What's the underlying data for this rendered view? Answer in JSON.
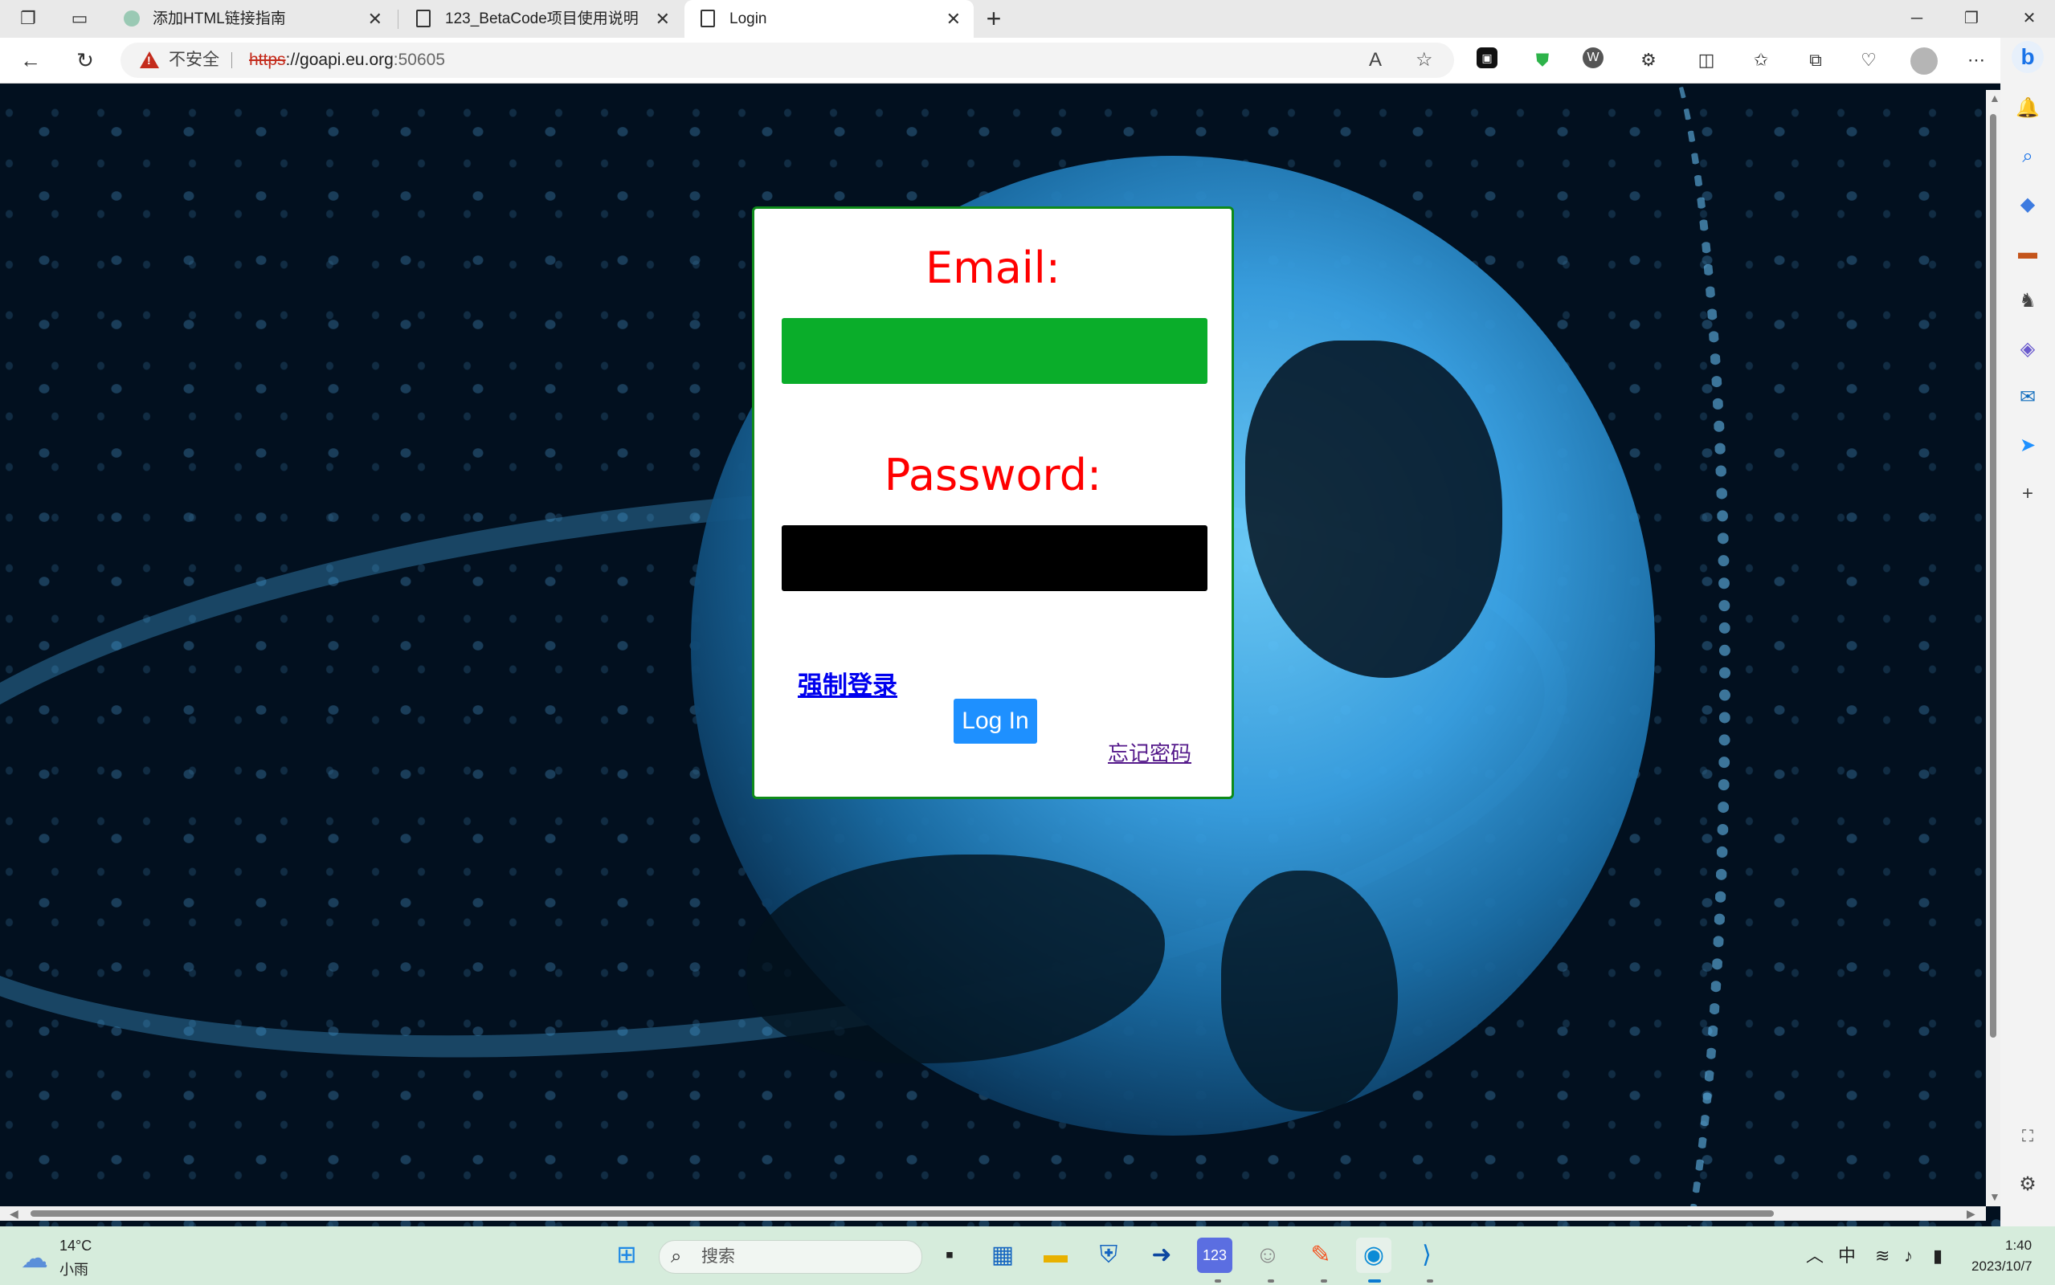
{
  "browser": {
    "tabs": [
      {
        "title": "添加HTML链接指南",
        "active": false
      },
      {
        "title": "123_BetaCode项目使用说明",
        "active": false
      },
      {
        "title": "Login",
        "active": true
      }
    ],
    "new_tab_icon": "plus-icon",
    "address": {
      "security_label": "不安全",
      "url_scheme": "https",
      "url_host": "://goapi.eu.org",
      "url_port": ":50605"
    }
  },
  "login": {
    "email_label": "Email:",
    "email_value": "",
    "password_label": "Password:",
    "password_value": "",
    "force_login_link": "强制登录",
    "login_button": "Log In",
    "forgot_password_link": "忘记密码"
  },
  "taskbar": {
    "weather_temp": "14°C",
    "weather_desc": "小雨",
    "search_placeholder": "搜索",
    "ime_label": "中",
    "time": "1:40",
    "date": "2023/10/7"
  },
  "colors": {
    "label_red": "#ff0000",
    "email_field": "#0aad2a",
    "password_field": "#000000",
    "button_blue": "#1e90ff",
    "card_border": "#0e8a1a"
  }
}
